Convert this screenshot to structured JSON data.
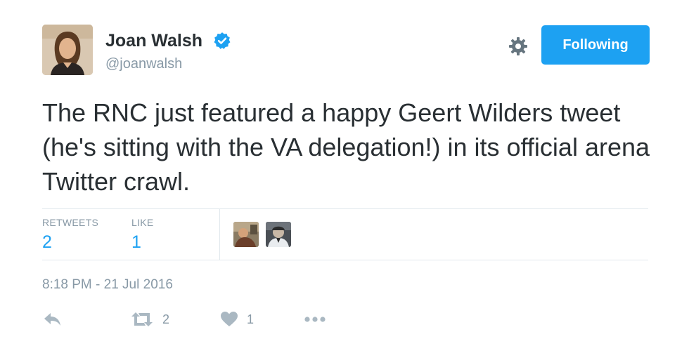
{
  "author": {
    "display_name": "Joan Walsh",
    "handle": "@joanwalsh",
    "verified": true,
    "avatar_icon": "user-photo"
  },
  "header": {
    "settings_icon": "gear-icon",
    "follow_button_label": "Following"
  },
  "tweet": {
    "text": "The RNC just featured a happy Geert Wilders tweet (he's sitting with the VA delegation!) in its official arena Twitter crawl."
  },
  "stats": {
    "retweets_label": "RETWEETS",
    "retweets_value": "2",
    "likes_label": "LIKE",
    "likes_value": "1"
  },
  "likers": [
    {
      "icon": "liker-avatar-1"
    },
    {
      "icon": "liker-avatar-2"
    }
  ],
  "timestamp": "8:18 PM - 21 Jul 2016",
  "actions": {
    "reply_icon": "reply-icon",
    "retweet_icon": "retweet-icon",
    "retweet_count": "2",
    "like_icon": "heart-icon",
    "like_count": "1",
    "more_icon": "more-icon"
  },
  "colors": {
    "accent": "#1da1f2",
    "text": "#292f33",
    "muted": "#8899a6",
    "divider": "#e1e8ed"
  }
}
